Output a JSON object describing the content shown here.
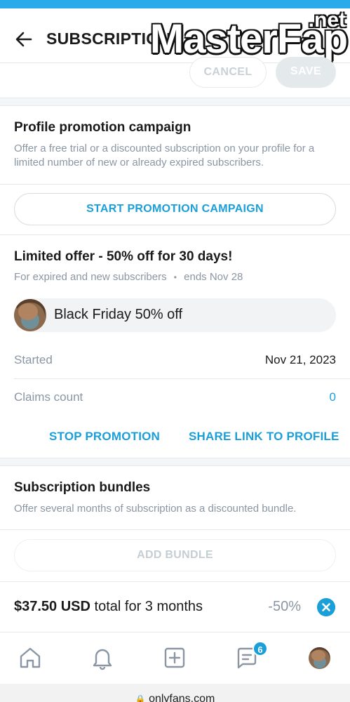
{
  "header": {
    "title": "SUBSCRIPTION",
    "watermark_main": "MasterFap",
    "watermark_suffix": ".net"
  },
  "actions": {
    "cancel_label": "CANCEL",
    "save_label": "SAVE"
  },
  "promotion_section": {
    "title": "Profile promotion campaign",
    "description": "Offer a free trial or a discounted subscription on your profile for a limited number of new or already expired subscribers.",
    "start_button": "START PROMOTION CAMPAIGN"
  },
  "active_offer": {
    "title": "Limited offer - 50% off for 30 days!",
    "audience": "For expired and new subscribers",
    "separator": "•",
    "ends": "ends Nov 28",
    "chip_label": "Black Friday 50% off",
    "started_label": "Started",
    "started_value": "Nov 21, 2023",
    "claims_label": "Claims count",
    "claims_value": "0",
    "stop_button": "STOP PROMOTION",
    "share_button": "SHARE LINK TO PROFILE"
  },
  "bundles_section": {
    "title": "Subscription bundles",
    "description": "Offer several months of subscription as a discounted bundle.",
    "add_button": "ADD BUNDLE",
    "bundle_price": "$37.50 USD",
    "bundle_term": " total for 3 months",
    "bundle_discount": "-50%"
  },
  "bottom_nav": {
    "items": [
      "home-icon",
      "bell-icon",
      "add-post-icon",
      "messages-icon",
      "profile-avatar"
    ],
    "messages_badge": "6"
  },
  "browser": {
    "url": "onlyfans.com"
  },
  "colors": {
    "accent": "#1a9fd9",
    "status_strip": "#28aaeb",
    "muted_text": "#8a96a3"
  }
}
